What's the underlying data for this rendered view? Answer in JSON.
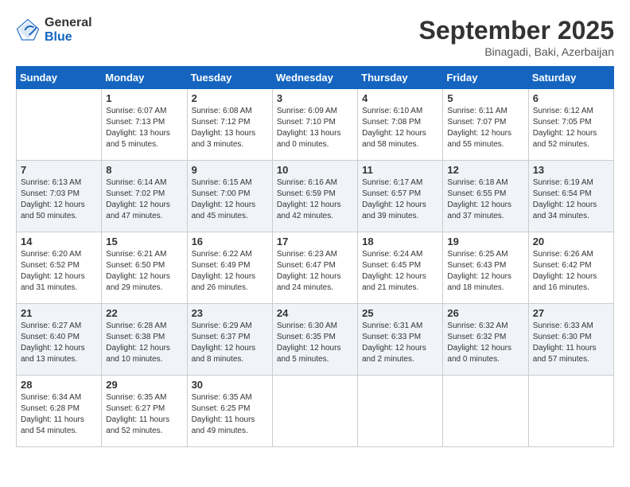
{
  "header": {
    "logo_general": "General",
    "logo_blue": "Blue",
    "month_title": "September 2025",
    "subtitle": "Binagadi, Baki, Azerbaijan"
  },
  "days_of_week": [
    "Sunday",
    "Monday",
    "Tuesday",
    "Wednesday",
    "Thursday",
    "Friday",
    "Saturday"
  ],
  "weeks": [
    [
      {
        "day": "",
        "sunrise": "",
        "sunset": "",
        "daylight": ""
      },
      {
        "day": "1",
        "sunrise": "Sunrise: 6:07 AM",
        "sunset": "Sunset: 7:13 PM",
        "daylight": "Daylight: 13 hours and 5 minutes."
      },
      {
        "day": "2",
        "sunrise": "Sunrise: 6:08 AM",
        "sunset": "Sunset: 7:12 PM",
        "daylight": "Daylight: 13 hours and 3 minutes."
      },
      {
        "day": "3",
        "sunrise": "Sunrise: 6:09 AM",
        "sunset": "Sunset: 7:10 PM",
        "daylight": "Daylight: 13 hours and 0 minutes."
      },
      {
        "day": "4",
        "sunrise": "Sunrise: 6:10 AM",
        "sunset": "Sunset: 7:08 PM",
        "daylight": "Daylight: 12 hours and 58 minutes."
      },
      {
        "day": "5",
        "sunrise": "Sunrise: 6:11 AM",
        "sunset": "Sunset: 7:07 PM",
        "daylight": "Daylight: 12 hours and 55 minutes."
      },
      {
        "day": "6",
        "sunrise": "Sunrise: 6:12 AM",
        "sunset": "Sunset: 7:05 PM",
        "daylight": "Daylight: 12 hours and 52 minutes."
      }
    ],
    [
      {
        "day": "7",
        "sunrise": "Sunrise: 6:13 AM",
        "sunset": "Sunset: 7:03 PM",
        "daylight": "Daylight: 12 hours and 50 minutes."
      },
      {
        "day": "8",
        "sunrise": "Sunrise: 6:14 AM",
        "sunset": "Sunset: 7:02 PM",
        "daylight": "Daylight: 12 hours and 47 minutes."
      },
      {
        "day": "9",
        "sunrise": "Sunrise: 6:15 AM",
        "sunset": "Sunset: 7:00 PM",
        "daylight": "Daylight: 12 hours and 45 minutes."
      },
      {
        "day": "10",
        "sunrise": "Sunrise: 6:16 AM",
        "sunset": "Sunset: 6:59 PM",
        "daylight": "Daylight: 12 hours and 42 minutes."
      },
      {
        "day": "11",
        "sunrise": "Sunrise: 6:17 AM",
        "sunset": "Sunset: 6:57 PM",
        "daylight": "Daylight: 12 hours and 39 minutes."
      },
      {
        "day": "12",
        "sunrise": "Sunrise: 6:18 AM",
        "sunset": "Sunset: 6:55 PM",
        "daylight": "Daylight: 12 hours and 37 minutes."
      },
      {
        "day": "13",
        "sunrise": "Sunrise: 6:19 AM",
        "sunset": "Sunset: 6:54 PM",
        "daylight": "Daylight: 12 hours and 34 minutes."
      }
    ],
    [
      {
        "day": "14",
        "sunrise": "Sunrise: 6:20 AM",
        "sunset": "Sunset: 6:52 PM",
        "daylight": "Daylight: 12 hours and 31 minutes."
      },
      {
        "day": "15",
        "sunrise": "Sunrise: 6:21 AM",
        "sunset": "Sunset: 6:50 PM",
        "daylight": "Daylight: 12 hours and 29 minutes."
      },
      {
        "day": "16",
        "sunrise": "Sunrise: 6:22 AM",
        "sunset": "Sunset: 6:49 PM",
        "daylight": "Daylight: 12 hours and 26 minutes."
      },
      {
        "day": "17",
        "sunrise": "Sunrise: 6:23 AM",
        "sunset": "Sunset: 6:47 PM",
        "daylight": "Daylight: 12 hours and 24 minutes."
      },
      {
        "day": "18",
        "sunrise": "Sunrise: 6:24 AM",
        "sunset": "Sunset: 6:45 PM",
        "daylight": "Daylight: 12 hours and 21 minutes."
      },
      {
        "day": "19",
        "sunrise": "Sunrise: 6:25 AM",
        "sunset": "Sunset: 6:43 PM",
        "daylight": "Daylight: 12 hours and 18 minutes."
      },
      {
        "day": "20",
        "sunrise": "Sunrise: 6:26 AM",
        "sunset": "Sunset: 6:42 PM",
        "daylight": "Daylight: 12 hours and 16 minutes."
      }
    ],
    [
      {
        "day": "21",
        "sunrise": "Sunrise: 6:27 AM",
        "sunset": "Sunset: 6:40 PM",
        "daylight": "Daylight: 12 hours and 13 minutes."
      },
      {
        "day": "22",
        "sunrise": "Sunrise: 6:28 AM",
        "sunset": "Sunset: 6:38 PM",
        "daylight": "Daylight: 12 hours and 10 minutes."
      },
      {
        "day": "23",
        "sunrise": "Sunrise: 6:29 AM",
        "sunset": "Sunset: 6:37 PM",
        "daylight": "Daylight: 12 hours and 8 minutes."
      },
      {
        "day": "24",
        "sunrise": "Sunrise: 6:30 AM",
        "sunset": "Sunset: 6:35 PM",
        "daylight": "Daylight: 12 hours and 5 minutes."
      },
      {
        "day": "25",
        "sunrise": "Sunrise: 6:31 AM",
        "sunset": "Sunset: 6:33 PM",
        "daylight": "Daylight: 12 hours and 2 minutes."
      },
      {
        "day": "26",
        "sunrise": "Sunrise: 6:32 AM",
        "sunset": "Sunset: 6:32 PM",
        "daylight": "Daylight: 12 hours and 0 minutes."
      },
      {
        "day": "27",
        "sunrise": "Sunrise: 6:33 AM",
        "sunset": "Sunset: 6:30 PM",
        "daylight": "Daylight: 11 hours and 57 minutes."
      }
    ],
    [
      {
        "day": "28",
        "sunrise": "Sunrise: 6:34 AM",
        "sunset": "Sunset: 6:28 PM",
        "daylight": "Daylight: 11 hours and 54 minutes."
      },
      {
        "day": "29",
        "sunrise": "Sunrise: 6:35 AM",
        "sunset": "Sunset: 6:27 PM",
        "daylight": "Daylight: 11 hours and 52 minutes."
      },
      {
        "day": "30",
        "sunrise": "Sunrise: 6:35 AM",
        "sunset": "Sunset: 6:25 PM",
        "daylight": "Daylight: 11 hours and 49 minutes."
      },
      {
        "day": "",
        "sunrise": "",
        "sunset": "",
        "daylight": ""
      },
      {
        "day": "",
        "sunrise": "",
        "sunset": "",
        "daylight": ""
      },
      {
        "day": "",
        "sunrise": "",
        "sunset": "",
        "daylight": ""
      },
      {
        "day": "",
        "sunrise": "",
        "sunset": "",
        "daylight": ""
      }
    ]
  ]
}
